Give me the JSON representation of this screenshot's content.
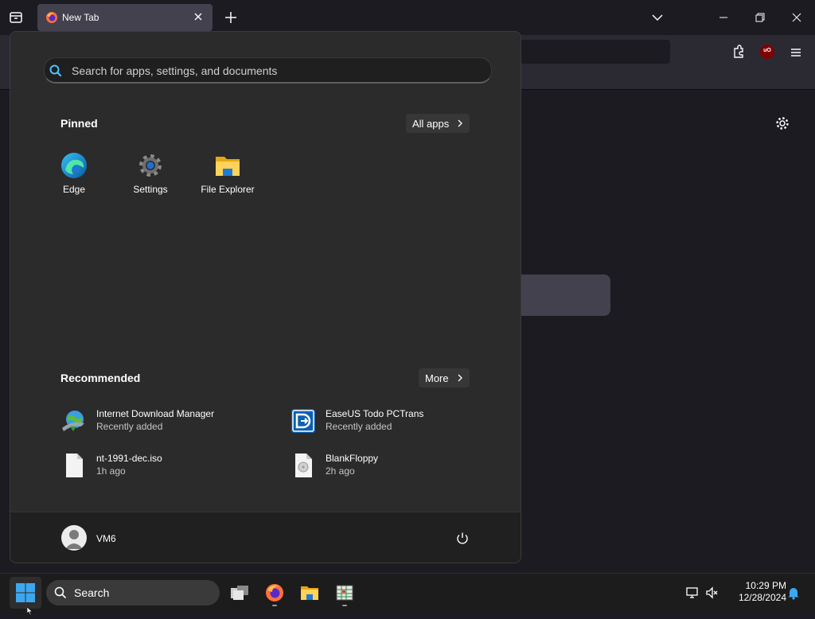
{
  "browser": {
    "tab_title": "New Tab",
    "ublock_label": "uO"
  },
  "start_menu": {
    "search_placeholder": "Search for apps, settings, and documents",
    "pinned": {
      "title": "Pinned",
      "all_apps_label": "All apps",
      "apps": [
        {
          "name": "Edge",
          "icon": "edge-icon"
        },
        {
          "name": "Settings",
          "icon": "settings-gear-icon"
        },
        {
          "name": "File Explorer",
          "icon": "folder-icon"
        }
      ]
    },
    "recommended": {
      "title": "Recommended",
      "more_label": "More",
      "items": [
        {
          "name": "Internet Download Manager",
          "sub": "Recently added",
          "icon": "idm-globe-icon"
        },
        {
          "name": "EaseUS Todo PCTrans",
          "sub": "Recently added",
          "icon": "easeus-pctrans-icon"
        },
        {
          "name": "nt-1991-dec.iso",
          "sub": "1h ago",
          "icon": "file-icon"
        },
        {
          "name": "BlankFloppy",
          "sub": "2h ago",
          "icon": "disc-file-icon"
        }
      ]
    },
    "user": {
      "name": "VM6"
    }
  },
  "taskbar": {
    "search_label": "Search",
    "apps": [
      "task-view-icon",
      "firefox-icon",
      "file-explorer-icon",
      "spreadsheet-app-icon"
    ],
    "time": "10:29 PM",
    "date": "12/28/2024"
  },
  "colors": {
    "accent": "#0078d4",
    "start_bg": "#2b2b2b",
    "browser_bg": "#1c1b22"
  }
}
